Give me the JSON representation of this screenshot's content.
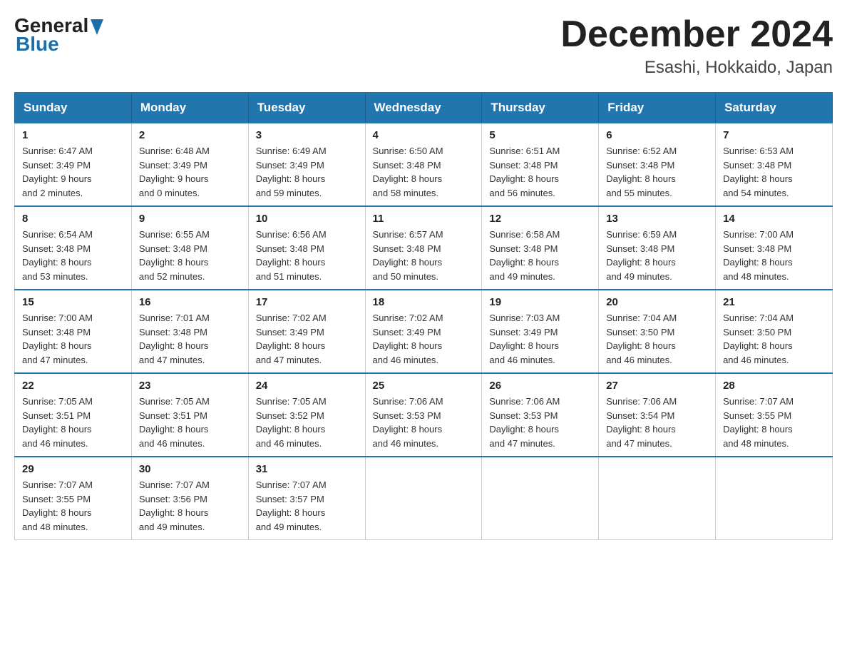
{
  "header": {
    "logo_general": "General",
    "logo_blue": "Blue",
    "month_title": "December 2024",
    "location": "Esashi, Hokkaido, Japan"
  },
  "weekdays": [
    "Sunday",
    "Monday",
    "Tuesday",
    "Wednesday",
    "Thursday",
    "Friday",
    "Saturday"
  ],
  "weeks": [
    [
      {
        "day": "1",
        "sunrise": "6:47 AM",
        "sunset": "3:49 PM",
        "daylight": "9 hours and 2 minutes."
      },
      {
        "day": "2",
        "sunrise": "6:48 AM",
        "sunset": "3:49 PM",
        "daylight": "9 hours and 0 minutes."
      },
      {
        "day": "3",
        "sunrise": "6:49 AM",
        "sunset": "3:49 PM",
        "daylight": "8 hours and 59 minutes."
      },
      {
        "day": "4",
        "sunrise": "6:50 AM",
        "sunset": "3:48 PM",
        "daylight": "8 hours and 58 minutes."
      },
      {
        "day": "5",
        "sunrise": "6:51 AM",
        "sunset": "3:48 PM",
        "daylight": "8 hours and 56 minutes."
      },
      {
        "day": "6",
        "sunrise": "6:52 AM",
        "sunset": "3:48 PM",
        "daylight": "8 hours and 55 minutes."
      },
      {
        "day": "7",
        "sunrise": "6:53 AM",
        "sunset": "3:48 PM",
        "daylight": "8 hours and 54 minutes."
      }
    ],
    [
      {
        "day": "8",
        "sunrise": "6:54 AM",
        "sunset": "3:48 PM",
        "daylight": "8 hours and 53 minutes."
      },
      {
        "day": "9",
        "sunrise": "6:55 AM",
        "sunset": "3:48 PM",
        "daylight": "8 hours and 52 minutes."
      },
      {
        "day": "10",
        "sunrise": "6:56 AM",
        "sunset": "3:48 PM",
        "daylight": "8 hours and 51 minutes."
      },
      {
        "day": "11",
        "sunrise": "6:57 AM",
        "sunset": "3:48 PM",
        "daylight": "8 hours and 50 minutes."
      },
      {
        "day": "12",
        "sunrise": "6:58 AM",
        "sunset": "3:48 PM",
        "daylight": "8 hours and 49 minutes."
      },
      {
        "day": "13",
        "sunrise": "6:59 AM",
        "sunset": "3:48 PM",
        "daylight": "8 hours and 49 minutes."
      },
      {
        "day": "14",
        "sunrise": "7:00 AM",
        "sunset": "3:48 PM",
        "daylight": "8 hours and 48 minutes."
      }
    ],
    [
      {
        "day": "15",
        "sunrise": "7:00 AM",
        "sunset": "3:48 PM",
        "daylight": "8 hours and 47 minutes."
      },
      {
        "day": "16",
        "sunrise": "7:01 AM",
        "sunset": "3:48 PM",
        "daylight": "8 hours and 47 minutes."
      },
      {
        "day": "17",
        "sunrise": "7:02 AM",
        "sunset": "3:49 PM",
        "daylight": "8 hours and 47 minutes."
      },
      {
        "day": "18",
        "sunrise": "7:02 AM",
        "sunset": "3:49 PM",
        "daylight": "8 hours and 46 minutes."
      },
      {
        "day": "19",
        "sunrise": "7:03 AM",
        "sunset": "3:49 PM",
        "daylight": "8 hours and 46 minutes."
      },
      {
        "day": "20",
        "sunrise": "7:04 AM",
        "sunset": "3:50 PM",
        "daylight": "8 hours and 46 minutes."
      },
      {
        "day": "21",
        "sunrise": "7:04 AM",
        "sunset": "3:50 PM",
        "daylight": "8 hours and 46 minutes."
      }
    ],
    [
      {
        "day": "22",
        "sunrise": "7:05 AM",
        "sunset": "3:51 PM",
        "daylight": "8 hours and 46 minutes."
      },
      {
        "day": "23",
        "sunrise": "7:05 AM",
        "sunset": "3:51 PM",
        "daylight": "8 hours and 46 minutes."
      },
      {
        "day": "24",
        "sunrise": "7:05 AM",
        "sunset": "3:52 PM",
        "daylight": "8 hours and 46 minutes."
      },
      {
        "day": "25",
        "sunrise": "7:06 AM",
        "sunset": "3:53 PM",
        "daylight": "8 hours and 46 minutes."
      },
      {
        "day": "26",
        "sunrise": "7:06 AM",
        "sunset": "3:53 PM",
        "daylight": "8 hours and 47 minutes."
      },
      {
        "day": "27",
        "sunrise": "7:06 AM",
        "sunset": "3:54 PM",
        "daylight": "8 hours and 47 minutes."
      },
      {
        "day": "28",
        "sunrise": "7:07 AM",
        "sunset": "3:55 PM",
        "daylight": "8 hours and 48 minutes."
      }
    ],
    [
      {
        "day": "29",
        "sunrise": "7:07 AM",
        "sunset": "3:55 PM",
        "daylight": "8 hours and 48 minutes."
      },
      {
        "day": "30",
        "sunrise": "7:07 AM",
        "sunset": "3:56 PM",
        "daylight": "8 hours and 49 minutes."
      },
      {
        "day": "31",
        "sunrise": "7:07 AM",
        "sunset": "3:57 PM",
        "daylight": "8 hours and 49 minutes."
      },
      null,
      null,
      null,
      null
    ]
  ],
  "sunrise_label": "Sunrise: ",
  "sunset_label": "Sunset: ",
  "daylight_label": "Daylight: "
}
